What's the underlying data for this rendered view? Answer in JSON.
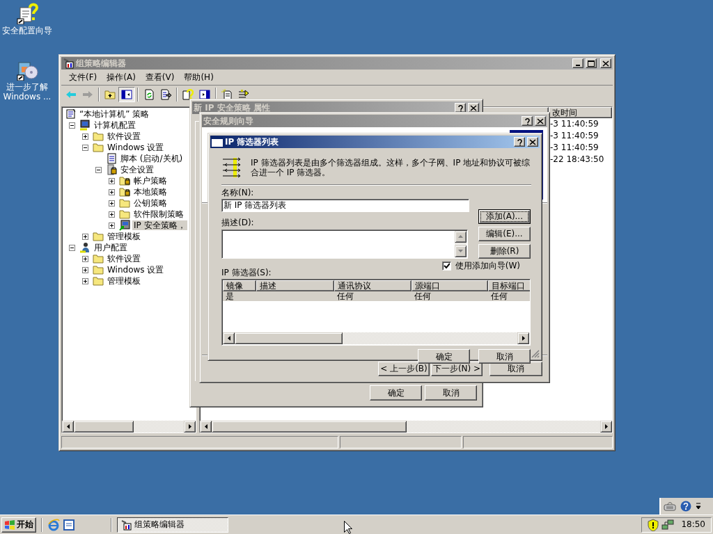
{
  "desktop_icons": [
    {
      "kind": "wizard",
      "label": "安全配置向导"
    },
    {
      "kind": "setup",
      "label": "进一步了解 Windows ..."
    }
  ],
  "main_window": {
    "title": "组策略编辑器",
    "active": false,
    "menu": [
      "文件(F)",
      "操作(A)",
      "查看(V)",
      "帮助(H)"
    ],
    "toolbar_groups": [
      [
        {
          "kind": "back",
          "pressed": false,
          "disabled": false
        },
        {
          "kind": "forward",
          "pressed": false,
          "disabled": true
        }
      ],
      [
        {
          "kind": "up",
          "pressed": false,
          "disabled": false
        },
        {
          "kind": "tree",
          "pressed": true,
          "disabled": false
        }
      ],
      [
        {
          "kind": "refresh",
          "pressed": false,
          "disabled": false
        },
        {
          "kind": "export",
          "pressed": false,
          "disabled": false
        }
      ],
      [
        {
          "kind": "help",
          "pressed": false,
          "disabled": false
        },
        {
          "kind": "pane",
          "pressed": false,
          "disabled": false
        }
      ],
      [
        {
          "kind": "new",
          "pressed": false,
          "disabled": false
        },
        {
          "kind": "arrows",
          "pressed": false,
          "disabled": false
        }
      ]
    ],
    "tree": [
      {
        "label": "“本地计算机” 策略",
        "kind": "policy",
        "selected": false,
        "children": [
          {
            "label": "计算机配置",
            "kind": "computer",
            "expanded": true,
            "selected": false,
            "children": [
              {
                "label": "软件设置",
                "kind": "folder",
                "expanded": false,
                "selected": false
              },
              {
                "label": "Windows 设置",
                "kind": "folder",
                "expanded": true,
                "selected": false,
                "children": [
                  {
                    "label": "脚本 (启动/关机)",
                    "kind": "script",
                    "selected": false
                  },
                  {
                    "label": "安全设置",
                    "kind": "secure",
                    "expanded": true,
                    "selected": false,
                    "children": [
                      {
                        "label": "帐户策略",
                        "kind": "lockfolder",
                        "expanded": false,
                        "selected": false
                      },
                      {
                        "label": "本地策略",
                        "kind": "lockfolder",
                        "expanded": false,
                        "selected": false
                      },
                      {
                        "label": "公钥策略",
                        "kind": "folder",
                        "expanded": false,
                        "selected": false
                      },
                      {
                        "label": "软件限制策略",
                        "kind": "folder",
                        "expanded": false,
                        "selected": false
                      },
                      {
                        "label": "IP 安全策略，",
                        "kind": "ippolicy",
                        "expanded": false,
                        "selected": true
                      }
                    ]
                  }
                ]
              },
              {
                "label": "管理模板",
                "kind": "folder",
                "expanded": false,
                "selected": false
              }
            ]
          },
          {
            "label": "用户配置",
            "kind": "user",
            "expanded": true,
            "selected": false,
            "children": [
              {
                "label": "软件设置",
                "kind": "folder",
                "expanded": false,
                "selected": false
              },
              {
                "label": "Windows 设置",
                "kind": "folder",
                "expanded": false,
                "selected": false
              },
              {
                "label": "管理模板",
                "kind": "folder",
                "expanded": false,
                "selected": false
              }
            ]
          }
        ]
      }
    ],
    "list": {
      "column_heading": "改时间",
      "rows": [
        "-3 11:40:59",
        "-3 11:40:59",
        "-3 11:40:59",
        "-22 18:43:50"
      ]
    }
  },
  "property_dialog": {
    "title": "新 IP 安全策略 属性",
    "active": false,
    "buttons": [
      "确定",
      "取消"
    ]
  },
  "wizard": {
    "title": "安全规则向导",
    "active": false,
    "nav_buttons": [
      "< 上一步(B)",
      "下一步(N) >"
    ],
    "cancel_button": "取消"
  },
  "filter_list_dialog": {
    "title": "IP 筛选器列表",
    "active": true,
    "intro": "IP 筛选器列表是由多个筛选器组成。这样，多个子网、IP 地址和协议可被综合进一个 IP 筛选器。",
    "name_label": "名称(N):",
    "name_value": "新 IP 筛选器列表",
    "description_label": "描述(D):",
    "side_buttons": [
      {
        "label": "添加(A)...",
        "focused": true
      },
      {
        "label": "编辑(E)...",
        "focused": false
      },
      {
        "label": "删除(R)",
        "focused": false
      }
    ],
    "wizard_checkbox": {
      "label": "使用添加向导(W)",
      "checked": true
    },
    "filters_label": "IP 筛选器(S):",
    "table": {
      "columns": [
        "镜像",
        "描述",
        "通讯协议",
        "源端口",
        "目标端口"
      ],
      "rows": [
        {
          "cells": [
            "是",
            null,
            "任何",
            "任何",
            "任何"
          ],
          "selected": true
        }
      ]
    },
    "buttons": [
      "确定",
      "取消"
    ]
  },
  "taskbar": {
    "start_label": "开始",
    "tasks": [
      {
        "label": "组策略编辑器",
        "pressed": true
      }
    ],
    "clock": "18:50"
  }
}
